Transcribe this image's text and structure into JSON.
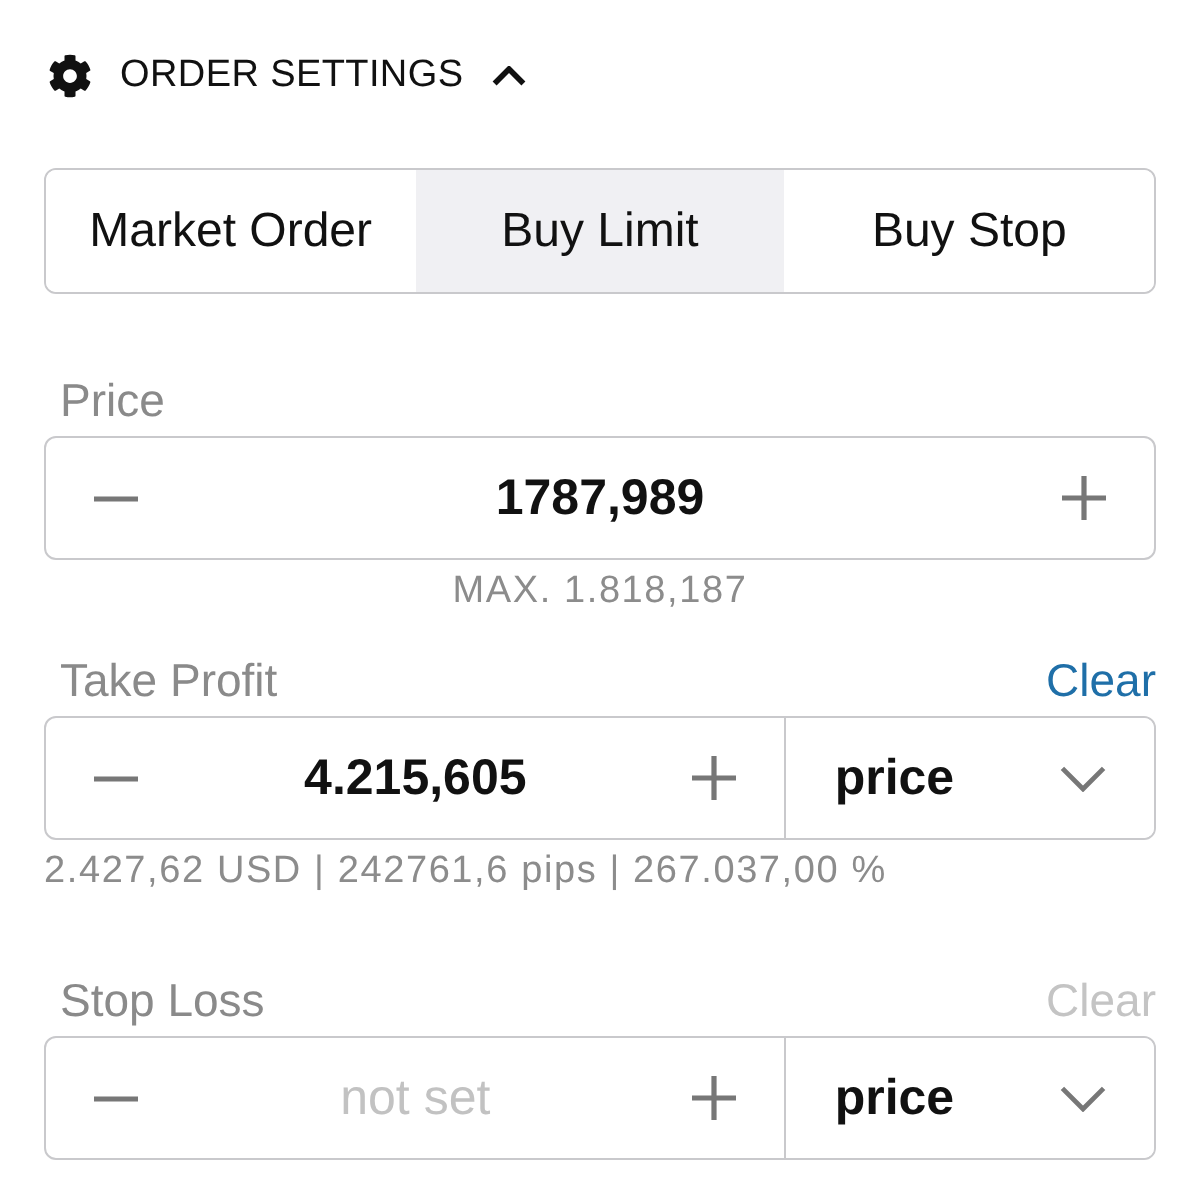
{
  "header": {
    "title": "ORDER SETTINGS",
    "expanded": true
  },
  "order_types": [
    {
      "label": "Market Order",
      "selected": false
    },
    {
      "label": "Buy Limit",
      "selected": true
    },
    {
      "label": "Buy Stop",
      "selected": false
    }
  ],
  "fields": [
    {
      "kind": "stepper",
      "label": "Price",
      "value": "1787,989",
      "note": "MAX. 1.818,187"
    },
    {
      "kind": "stepper_select",
      "label": "Take Profit",
      "clear": {
        "label": "Clear",
        "disabled": false
      },
      "value": "4.215,605",
      "unit": "price",
      "note": "2.427,62 USD | 242761,6 pips | 267.037,00 %"
    },
    {
      "kind": "stepper_select",
      "label": "Stop Loss",
      "clear": {
        "label": "Clear",
        "disabled": true
      },
      "placeholder": "not set",
      "unit": "price"
    }
  ]
}
